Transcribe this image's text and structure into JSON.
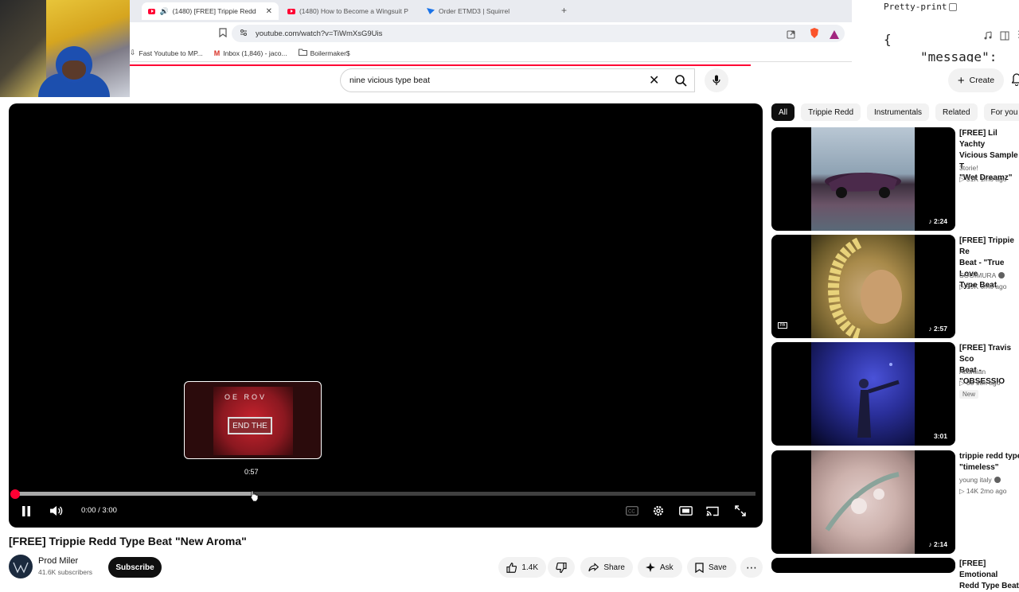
{
  "browser": {
    "tabs": [
      {
        "title": "(1480) [FREE] Trippie Redd Ty",
        "active": true
      },
      {
        "title": "(1480) How to Become a Wingsuit P",
        "active": false
      },
      {
        "title": "Order ETMD3 | Squirrel",
        "active": false
      }
    ],
    "add_tab": "+",
    "url": "youtube.com/watch?v=TiWmXsG9Uis",
    "bookmarks": [
      {
        "label": "Fast Youtube to MP..."
      },
      {
        "label": "Inbox (1,846) - jaco..."
      },
      {
        "label": "Boilermaker$"
      }
    ]
  },
  "json_overlay": {
    "pretty_print_label": "Pretty-print",
    "open_brace": "{",
    "key": "\"message\":",
    "value": "\"\"",
    "close_brace": "}"
  },
  "youtube": {
    "search_query": "nine vicious type beat",
    "create_label": "Create",
    "player": {
      "hover_time": "0:57",
      "timecode": "0:00 / 3:00",
      "progress_fraction": 0.0,
      "hover_fraction": 0.32,
      "preview_top_text": "OE ROV",
      "preview_label": "END THE"
    },
    "video_title": "[FREE] Trippie Redd Type Beat \"New Aroma\"",
    "channel": {
      "name": "Prod Miler",
      "subscribers": "41.6K subscribers"
    },
    "subscribe_label": "Subscribe",
    "actions": {
      "likes": "1.4K",
      "share": "Share",
      "ask": "Ask",
      "save": "Save"
    },
    "chips": [
      "All",
      "Trippie Redd",
      "Instrumentals",
      "Related",
      "For you"
    ],
    "recommendations": [
      {
        "title": "[FREE] Lil Yachty\nVicious Sample T\n\"Wet Dreamz\"",
        "channel": "3torie!",
        "meta": "▷ 31K   1mo ago",
        "duration": "♪ 2:24",
        "verified": false,
        "new": false
      },
      {
        "title": "[FREE] Trippie Re\nBeat - \"True Love\nType Beat",
        "channel": "SOGIMURA",
        "meta": "▷ 99K   6mo ago",
        "duration": "♪ 2:57",
        "verified": true,
        "new": false
      },
      {
        "title": "[FREE] Travis Sco\nBeat - \"OBSESSIO",
        "channel": "Atlantian",
        "meta": "▷ 33   18h ago",
        "duration": "3:01",
        "verified": false,
        "new": true,
        "new_label": "New"
      },
      {
        "title": "trippie redd type\n\"timeless\"",
        "channel": "young italy",
        "meta": "▷ 14K   2mo ago",
        "duration": "♪ 2:14",
        "verified": true,
        "new": false
      },
      {
        "title": "[FREE] Emotional\nRedd Type Beat",
        "channel": "",
        "meta": "",
        "duration": "",
        "verified": false,
        "new": false
      }
    ]
  },
  "colors": {
    "brand_red": "#ff0033",
    "player_bg": "#000000",
    "chip_active": "#0f0f0f"
  }
}
